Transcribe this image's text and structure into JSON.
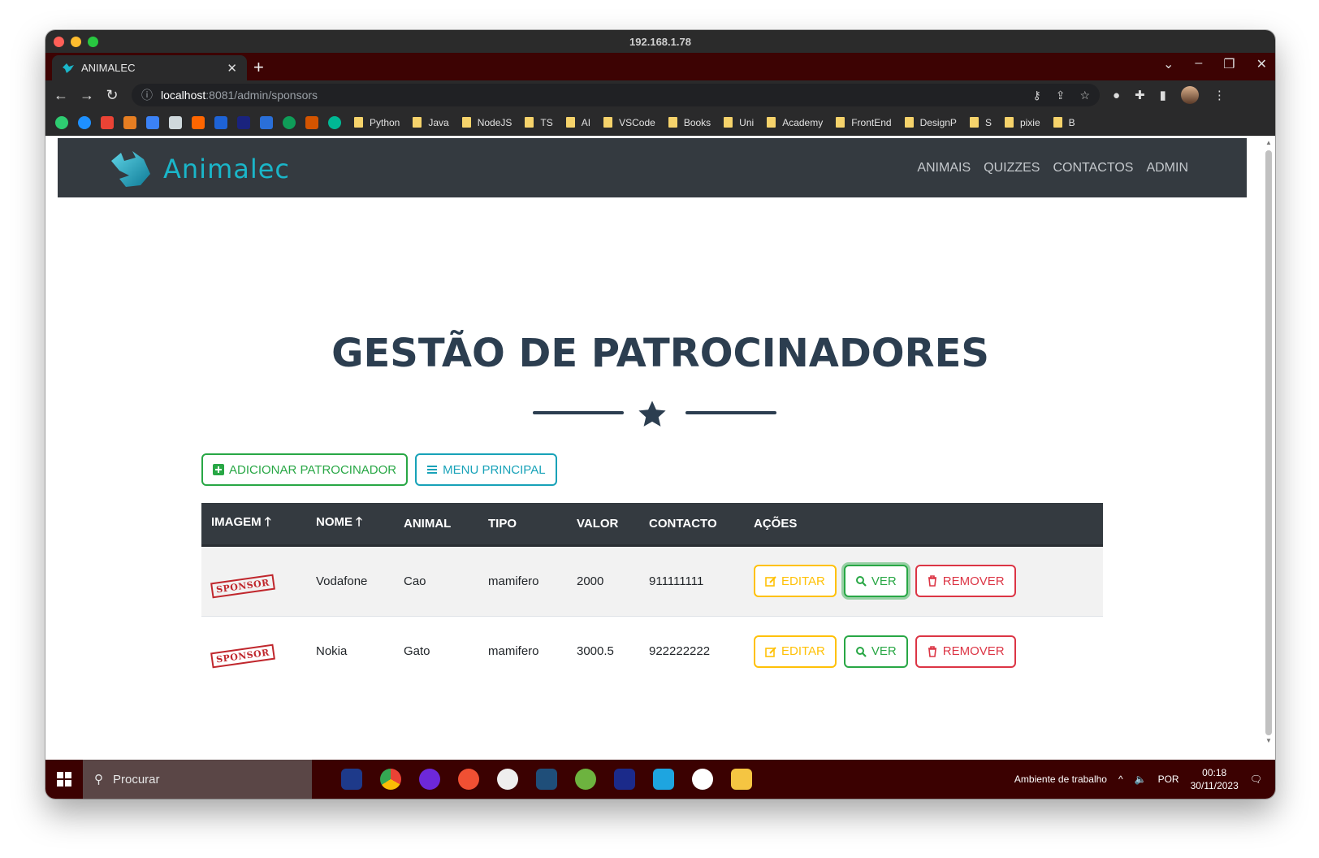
{
  "browser": {
    "window_title": "192.168.1.78",
    "tab_title": "ANIMALEC",
    "url_host": "localhost",
    "url_rest": ":8081/admin/sponsors",
    "bookmarks": [
      "Python",
      "Java",
      "NodeJS",
      "TS",
      "AI",
      "VSCode",
      "Books",
      "Uni",
      "Academy",
      "FrontEnd",
      "DesignP",
      "S",
      "pixie",
      "B"
    ]
  },
  "site": {
    "brand": "Animalec",
    "menu": [
      "ANIMAIS",
      "QUIZZES",
      "CONTACTOS",
      "ADMIN"
    ]
  },
  "page": {
    "title": "GESTÃO DE PATROCINADORES",
    "add_button": "ADICIONAR PATROCINADOR",
    "menu_button": "MENU PRINCIPAL"
  },
  "table": {
    "headers": [
      "IMAGEM",
      "NOME",
      "ANIMAL",
      "TIPO",
      "VALOR",
      "CONTACTO",
      "AÇÕES"
    ],
    "rows": [
      {
        "image": "SPONSOR",
        "name": "Vodafone",
        "animal": "Cao",
        "type": "mamifero",
        "value": "2000",
        "contact": "911111111"
      },
      {
        "image": "SPONSOR",
        "name": "Nokia",
        "animal": "Gato",
        "type": "mamifero",
        "value": "3000.5",
        "contact": "922222222"
      }
    ],
    "actions": {
      "edit": "EDITAR",
      "view": "VER",
      "remove": "REMOVER"
    }
  },
  "taskbar": {
    "search_placeholder": "Procurar",
    "desktop_label": "Ambiente de trabalho",
    "language": "POR",
    "time": "00:18",
    "date": "30/11/2023"
  },
  "colors": {
    "nav_bg": "#343a40",
    "brand": "#1ab6c9",
    "title": "#2c3e50",
    "success": "#28a745",
    "info": "#17a2b8",
    "warning": "#ffc107",
    "danger": "#dc3545",
    "tabstrip": "#3d0303"
  }
}
